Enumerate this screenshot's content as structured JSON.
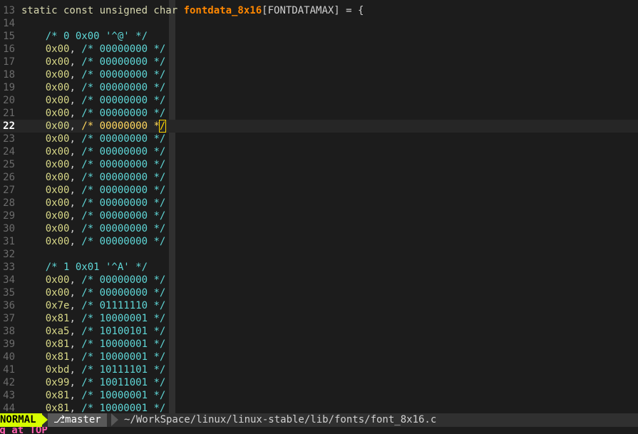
{
  "editor": {
    "cursor_line": "22",
    "lines": [
      {
        "num": "13",
        "kind": "decl",
        "kw": "static const unsigned char ",
        "fn": "fontdata_8x16",
        "rest": "[FONTDATAMAX] = {"
      },
      {
        "num": "14",
        "kind": "blank"
      },
      {
        "num": "15",
        "kind": "header",
        "text": "    /* 0 0x00 '^@' */"
      },
      {
        "num": "16",
        "kind": "data",
        "hex": "0x00",
        "bits": "00000000"
      },
      {
        "num": "17",
        "kind": "data",
        "hex": "0x00",
        "bits": "00000000"
      },
      {
        "num": "18",
        "kind": "data",
        "hex": "0x00",
        "bits": "00000000"
      },
      {
        "num": "19",
        "kind": "data",
        "hex": "0x00",
        "bits": "00000000"
      },
      {
        "num": "20",
        "kind": "data",
        "hex": "0x00",
        "bits": "00000000"
      },
      {
        "num": "21",
        "kind": "data",
        "hex": "0x00",
        "bits": "00000000"
      },
      {
        "num": "22",
        "kind": "data",
        "hex": "0x00",
        "bits": "00000000",
        "current": true
      },
      {
        "num": "23",
        "kind": "data",
        "hex": "0x00",
        "bits": "00000000"
      },
      {
        "num": "24",
        "kind": "data",
        "hex": "0x00",
        "bits": "00000000"
      },
      {
        "num": "25",
        "kind": "data",
        "hex": "0x00",
        "bits": "00000000"
      },
      {
        "num": "26",
        "kind": "data",
        "hex": "0x00",
        "bits": "00000000"
      },
      {
        "num": "27",
        "kind": "data",
        "hex": "0x00",
        "bits": "00000000"
      },
      {
        "num": "28",
        "kind": "data",
        "hex": "0x00",
        "bits": "00000000"
      },
      {
        "num": "29",
        "kind": "data",
        "hex": "0x00",
        "bits": "00000000"
      },
      {
        "num": "30",
        "kind": "data",
        "hex": "0x00",
        "bits": "00000000"
      },
      {
        "num": "31",
        "kind": "data",
        "hex": "0x00",
        "bits": "00000000"
      },
      {
        "num": "32",
        "kind": "blank"
      },
      {
        "num": "33",
        "kind": "header",
        "text": "    /* 1 0x01 '^A' */"
      },
      {
        "num": "34",
        "kind": "data",
        "hex": "0x00",
        "bits": "00000000"
      },
      {
        "num": "35",
        "kind": "data",
        "hex": "0x00",
        "bits": "00000000"
      },
      {
        "num": "36",
        "kind": "data",
        "hex": "0x7e",
        "bits": "01111110"
      },
      {
        "num": "37",
        "kind": "data",
        "hex": "0x81",
        "bits": "10000001"
      },
      {
        "num": "38",
        "kind": "data",
        "hex": "0xa5",
        "bits": "10100101"
      },
      {
        "num": "39",
        "kind": "data",
        "hex": "0x81",
        "bits": "10000001"
      },
      {
        "num": "40",
        "kind": "data",
        "hex": "0x81",
        "bits": "10000001"
      },
      {
        "num": "41",
        "kind": "data",
        "hex": "0xbd",
        "bits": "10111101"
      },
      {
        "num": "42",
        "kind": "data",
        "hex": "0x99",
        "bits": "10011001"
      },
      {
        "num": "43",
        "kind": "data",
        "hex": "0x81",
        "bits": "10000001"
      },
      {
        "num": "44",
        "kind": "data",
        "hex": "0x81",
        "bits": "10000001"
      }
    ]
  },
  "statusbar": {
    "mode": "NORMAL",
    "branch_glyph": "⎇",
    "branch": "master",
    "filepath": "~/WorkSpace/linux/linux-stable/lib/fonts/font_8x16.c"
  },
  "message": "ng at TOP",
  "colors": {
    "background": "#1c1c1c",
    "keyword": "#d7d7af",
    "identifier": "#ff8700",
    "hex": "#d7d787",
    "comment": "#5fd7d7",
    "mode_bg": "#d7ff00",
    "message": "#ff5faf"
  }
}
